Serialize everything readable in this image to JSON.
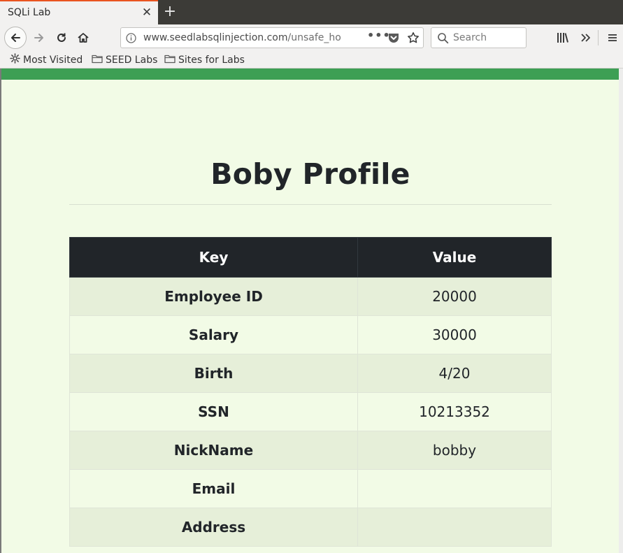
{
  "browser": {
    "tab_title": "SQLi Lab",
    "url_host": "www.seedlabsqlinjection.com",
    "url_path": "/unsafe_ho",
    "search_placeholder": "Search",
    "bookmarks": [
      "Most Visited",
      "SEED Labs",
      "Sites for Labs"
    ],
    "icons": {
      "tab_close": "close-icon",
      "new_tab": "plus-icon",
      "back": "back-arrow-icon",
      "forward": "forward-arrow-icon",
      "reload": "reload-icon",
      "home": "home-icon",
      "site_info": "info-icon",
      "page_actions": "ellipsis-icon",
      "pocket": "pocket-icon",
      "bookmark_star": "star-icon",
      "search": "search-icon",
      "library": "library-icon",
      "overflow": "chevron-double-right-icon",
      "menu": "hamburger-menu-icon",
      "bookmark_gear": "gear-icon",
      "bookmark_folder": "folder-icon"
    },
    "colors": {
      "tab_accent": "#e95420",
      "page_stripe": "#3d9f54",
      "page_background": "#f2fbe6"
    }
  },
  "page": {
    "title": "Boby Profile",
    "table": {
      "headers": [
        "Key",
        "Value"
      ],
      "rows": [
        {
          "key": "Employee ID",
          "value": "20000"
        },
        {
          "key": "Salary",
          "value": "30000"
        },
        {
          "key": "Birth",
          "value": "4/20"
        },
        {
          "key": "SSN",
          "value": "10213352"
        },
        {
          "key": "NickName",
          "value": "bobby"
        },
        {
          "key": "Email",
          "value": ""
        },
        {
          "key": "Address",
          "value": ""
        }
      ]
    }
  }
}
